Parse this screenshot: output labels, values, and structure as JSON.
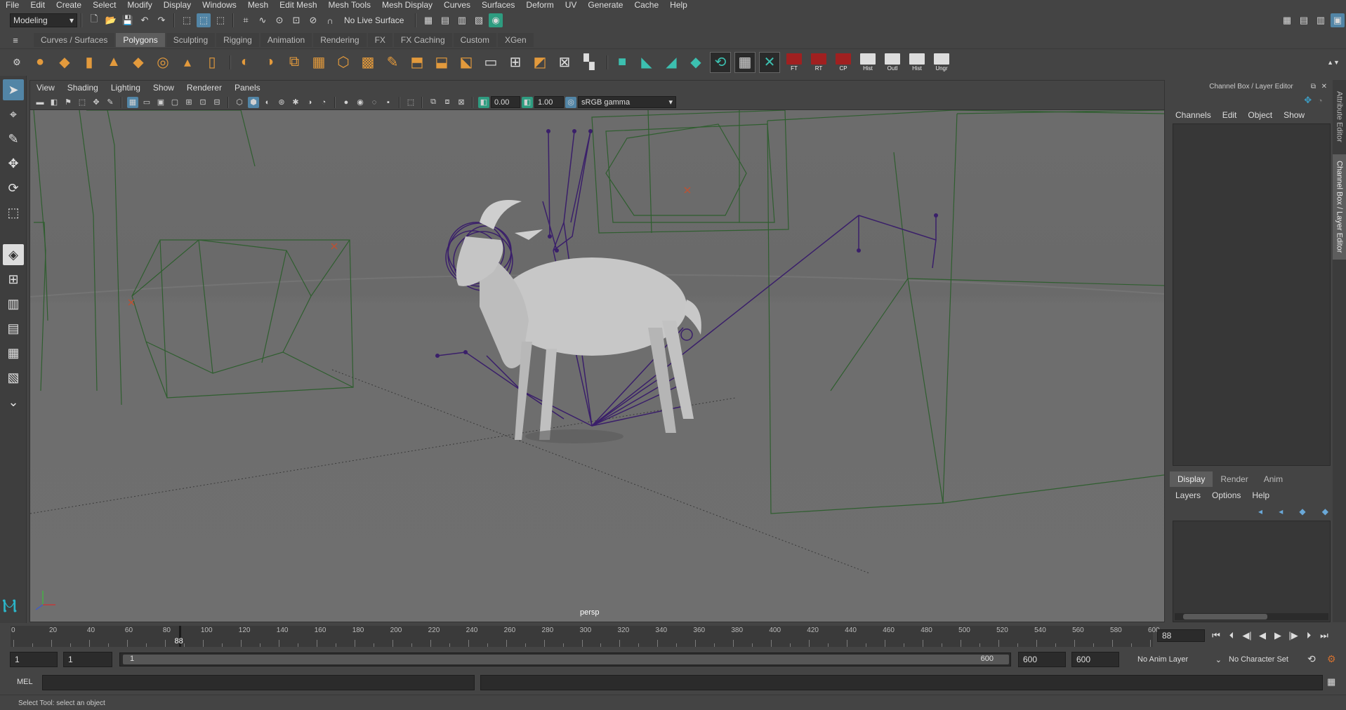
{
  "menu": [
    "File",
    "Edit",
    "Create",
    "Select",
    "Modify",
    "Display",
    "Windows",
    "Mesh",
    "Edit Mesh",
    "Mesh Tools",
    "Mesh Display",
    "Curves",
    "Surfaces",
    "Deform",
    "UV",
    "Generate",
    "Cache",
    "Help"
  ],
  "status_line": {
    "mode": "Modeling",
    "live_surface": "No Live Surface"
  },
  "shelf_tabs": [
    "Curves / Surfaces",
    "Polygons",
    "Sculpting",
    "Rigging",
    "Animation",
    "Rendering",
    "FX",
    "FX Caching",
    "Custom",
    "XGen"
  ],
  "shelf_active_tab": "Polygons",
  "shelf_text_buttons": [
    "FT",
    "RT",
    "CP",
    "Hist",
    "Outl",
    "Hist",
    "Ungr"
  ],
  "viewport": {
    "menu": [
      "View",
      "Shading",
      "Lighting",
      "Show",
      "Renderer",
      "Panels"
    ],
    "exposure": "0.00",
    "gamma": "1.00",
    "color_space": "sRGB gamma",
    "camera": "persp"
  },
  "channel_box": {
    "title": "Channel Box / Layer Editor",
    "menu": [
      "Channels",
      "Edit",
      "Object",
      "Show"
    ]
  },
  "layer_editor": {
    "tabs": [
      "Display",
      "Render",
      "Anim"
    ],
    "active_tab": "Display",
    "menu": [
      "Layers",
      "Options",
      "Help"
    ]
  },
  "side_tabs": [
    "Attribute Editor",
    "Channel Box / Layer Editor"
  ],
  "time_slider": {
    "start": 0,
    "end": 600,
    "major_labels": [
      0,
      20,
      40,
      60,
      80,
      100,
      120,
      140,
      160,
      180,
      200,
      220,
      240,
      260,
      280,
      300,
      320,
      340,
      360,
      380,
      400,
      420,
      440,
      460,
      480,
      500,
      520,
      540,
      560,
      580,
      600
    ],
    "current_frame": "88",
    "frame_field": "88"
  },
  "range_slider": {
    "start_field": "1",
    "playback_start": "1",
    "bar_start": "1",
    "bar_end": "600",
    "playback_end": "600",
    "end_field": "600",
    "anim_layer": "No Anim Layer",
    "character_set": "No Character Set"
  },
  "command_line": {
    "label": "MEL"
  },
  "help_line": "Select Tool: select an object",
  "colors": {
    "ui_bg": "#444444",
    "field_bg": "#2b2b2b",
    "highlight": "#5285a6",
    "viewport_bg": "#6b6b6b",
    "wire_green": "#2f5e2f",
    "rig_purple": "#3a1f6a"
  }
}
